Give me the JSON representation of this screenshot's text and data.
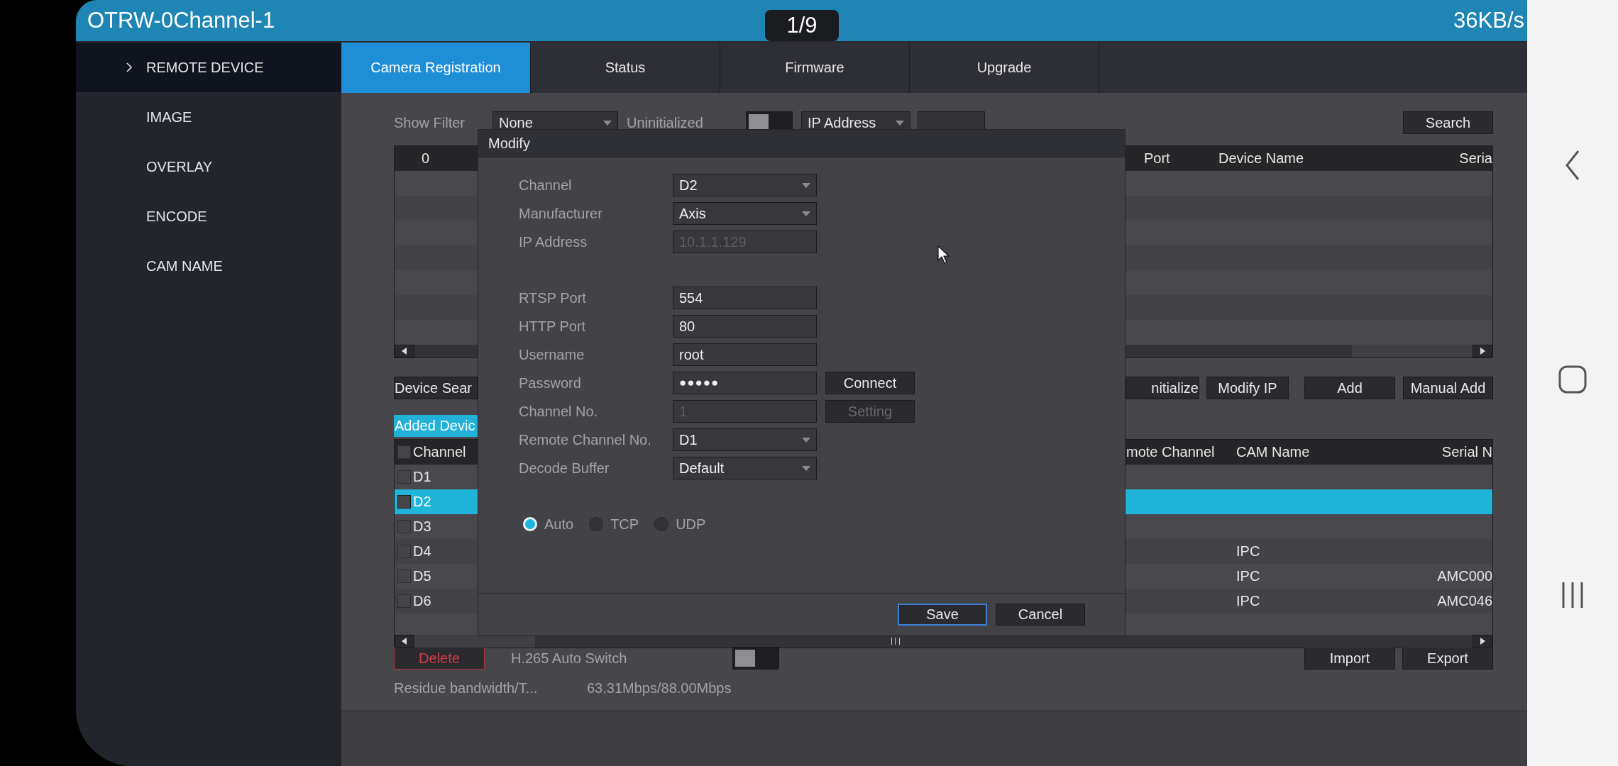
{
  "status_bar": {
    "title": "OTRW-0Channel-1",
    "page_indicator": "1/9",
    "speed": "36KB/s"
  },
  "sidebar": {
    "items": [
      {
        "label": "REMOTE DEVICE",
        "selected": true
      },
      {
        "label": "IMAGE",
        "selected": false
      },
      {
        "label": "OVERLAY",
        "selected": false
      },
      {
        "label": "ENCODE",
        "selected": false
      },
      {
        "label": "CAM NAME",
        "selected": false
      }
    ]
  },
  "tabs": [
    {
      "label": "Camera Registration",
      "selected": true
    },
    {
      "label": "Status",
      "selected": false
    },
    {
      "label": "Firmware",
      "selected": false
    },
    {
      "label": "Upgrade",
      "selected": false
    }
  ],
  "filter": {
    "label": "Show Filter",
    "value": "None",
    "uninitialized_label": "Uninitialized",
    "uninitialized_on": false,
    "search_by": "IP Address",
    "search_button": "Search"
  },
  "discovered_table": {
    "columns": [
      "0",
      "Port",
      "Device Name",
      "Seria"
    ]
  },
  "device_actions": [
    "Device Sear",
    "nitialize",
    "Modify IP",
    "Add",
    "Manual Add"
  ],
  "added_tab": {
    "label": "Added Devic",
    "selected": true
  },
  "added_table": {
    "all_checked": false,
    "columns": [
      "Channel",
      "mote Channel",
      "CAM Name",
      "Serial N"
    ],
    "rows": [
      {
        "channel": "D1",
        "selected": false,
        "checked": false
      },
      {
        "channel": "D2",
        "selected": true,
        "checked": false
      },
      {
        "channel": "D3",
        "selected": false,
        "checked": false
      },
      {
        "channel": "D4",
        "cam_name": "IPC",
        "selected": false,
        "checked": false
      },
      {
        "channel": "D5",
        "cam_name": "IPC",
        "serial": "AMC000",
        "selected": false,
        "checked": false
      },
      {
        "channel": "D6",
        "cam_name": "IPC",
        "serial": "AMC046",
        "selected": false,
        "checked": false
      }
    ]
  },
  "footer": {
    "delete_button": "Delete",
    "h265_label": "H.265 Auto Switch",
    "h265_on": false,
    "import_button": "Import",
    "export_button": "Export",
    "bandwidth_label": "Residue bandwidth/T...",
    "bandwidth_value": "63.31Mbps/88.00Mbps"
  },
  "modal": {
    "title": "Modify",
    "groups": [
      [
        {
          "kind": "select",
          "label": "Channel",
          "value": "D2",
          "disabled": false
        },
        {
          "kind": "select",
          "label": "Manufacturer",
          "value": "Axis",
          "disabled": false
        },
        {
          "kind": "text",
          "label": "IP Address",
          "value": "10.1.1.129",
          "disabled": true
        }
      ],
      [
        {
          "kind": "text",
          "label": "RTSP Port",
          "value": "554",
          "disabled": false
        },
        {
          "kind": "text",
          "label": "HTTP Port",
          "value": "80",
          "disabled": false
        },
        {
          "kind": "text",
          "label": "Username",
          "value": "root",
          "disabled": false
        },
        {
          "kind": "password",
          "label": "Password",
          "value": "●●●●●",
          "disabled": false,
          "button": {
            "label": "Connect",
            "disabled": false
          }
        },
        {
          "kind": "text",
          "label": "Channel No.",
          "value": "1",
          "disabled": true,
          "button": {
            "label": "Setting",
            "disabled": true
          }
        },
        {
          "kind": "select",
          "label": "Remote Channel No.",
          "value": "D1",
          "disabled": false
        },
        {
          "kind": "select",
          "label": "Decode Buffer",
          "value": "Default",
          "disabled": false
        }
      ]
    ],
    "protocols": [
      {
        "label": "Auto",
        "selected": true
      },
      {
        "label": "TCP",
        "selected": false
      },
      {
        "label": "UDP",
        "selected": false
      }
    ],
    "buttons": [
      {
        "label": "Save",
        "focused": true
      },
      {
        "label": "Cancel",
        "focused": false
      }
    ]
  }
}
